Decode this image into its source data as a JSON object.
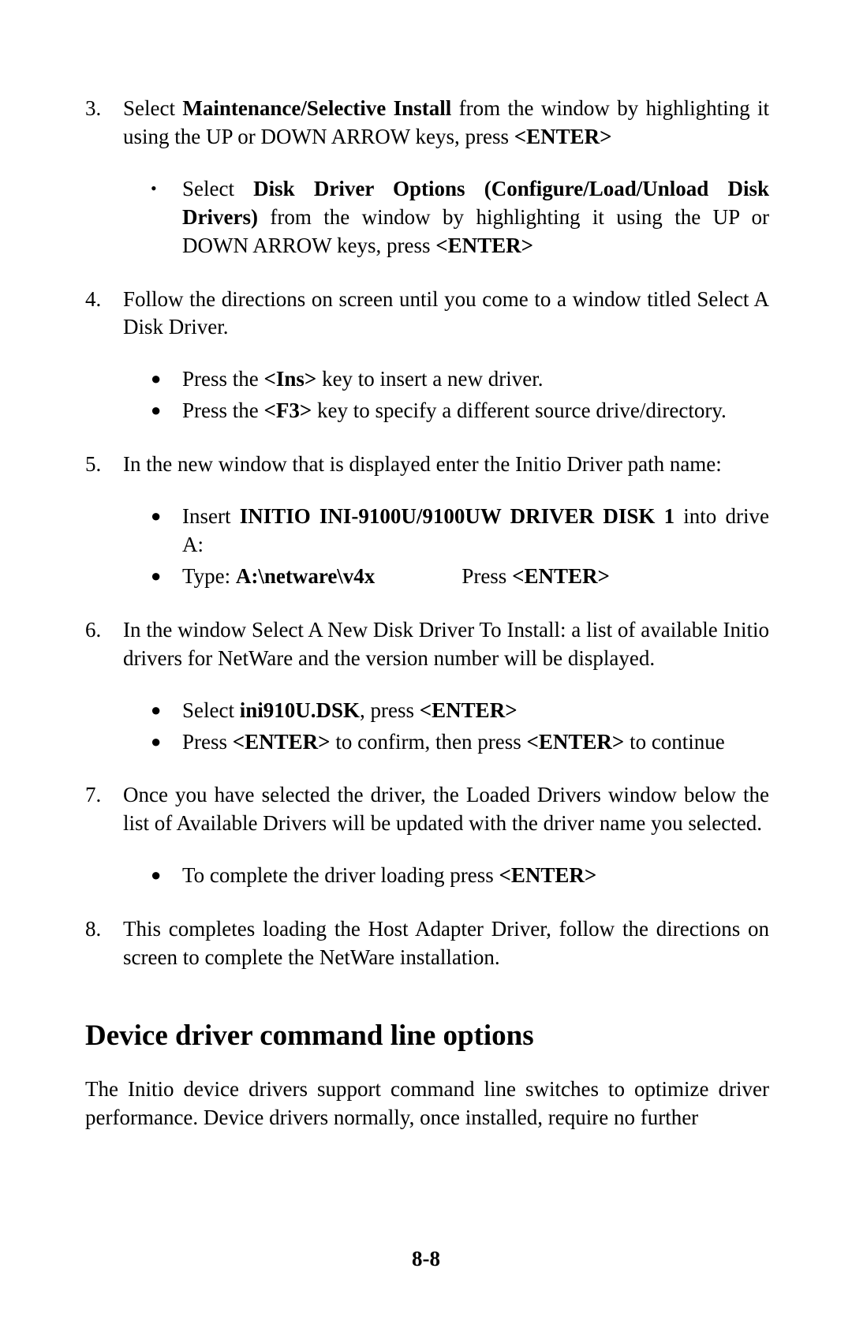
{
  "steps": {
    "s3": {
      "num": "3.",
      "text_parts": [
        "Select ",
        "Maintenance/Selective Install",
        " from the window by highlighting it using the UP or DOWN ARROW keys, press ",
        "<ENTER>"
      ],
      "sub": [
        {
          "parts": [
            "Select ",
            "Disk Driver Options (Configure/Load/Unload Disk Drivers)",
            " from the window by highlighting it using the UP or DOWN ARROW keys, press ",
            "<ENTER>"
          ]
        }
      ]
    },
    "s4": {
      "num": "4.",
      "text": "Follow the directions on screen until you come to a window titled Select A Disk Driver.",
      "sub": [
        {
          "parts": [
            "Press the  ",
            "<Ins>",
            " key to insert a new driver."
          ]
        },
        {
          "parts": [
            "Press the  ",
            "<F3>",
            "  key to specify a different source drive/directory."
          ]
        }
      ]
    },
    "s5": {
      "num": "5.",
      "text": "In the new window that is displayed enter the Initio Driver path name:",
      "sub": [
        {
          "parts": [
            "Insert ",
            "INITIO INI-9100U/9100UW DRIVER DISK 1",
            " into drive A:"
          ]
        },
        {
          "type_prefix": "Type: ",
          "type_path": "A:\\netware\\v4x",
          "press_label": "Press ",
          "enter": "<ENTER>"
        }
      ]
    },
    "s6": {
      "num": "6.",
      "text": "In the window Select A New Disk Driver To Install: a list of available Initio drivers for NetWare and the version number will be displayed.",
      "sub": [
        {
          "parts": [
            "Select ",
            "ini910U.DSK",
            ", press ",
            "<ENTER>"
          ]
        },
        {
          "parts": [
            "Press ",
            "<ENTER>",
            " to confirm, then press ",
            "<ENTER>",
            " to continue"
          ]
        }
      ]
    },
    "s7": {
      "num": "7.",
      "text": "Once you have selected the driver, the Loaded Drivers window below the list of Available Drivers will be updated with the driver name you selected.",
      "sub": [
        {
          "parts": [
            "To complete the driver loading press ",
            "<ENTER>"
          ]
        }
      ]
    },
    "s8": {
      "num": "8.",
      "text": "This completes loading the Host Adapter Driver, follow the directions on screen to complete the NetWare installation."
    }
  },
  "section_title": "Device driver command line options",
  "body_para": "The Initio device drivers support command line switches to optimize driver performance. Device drivers normally, once installed, require no further",
  "page_number": "8-8"
}
